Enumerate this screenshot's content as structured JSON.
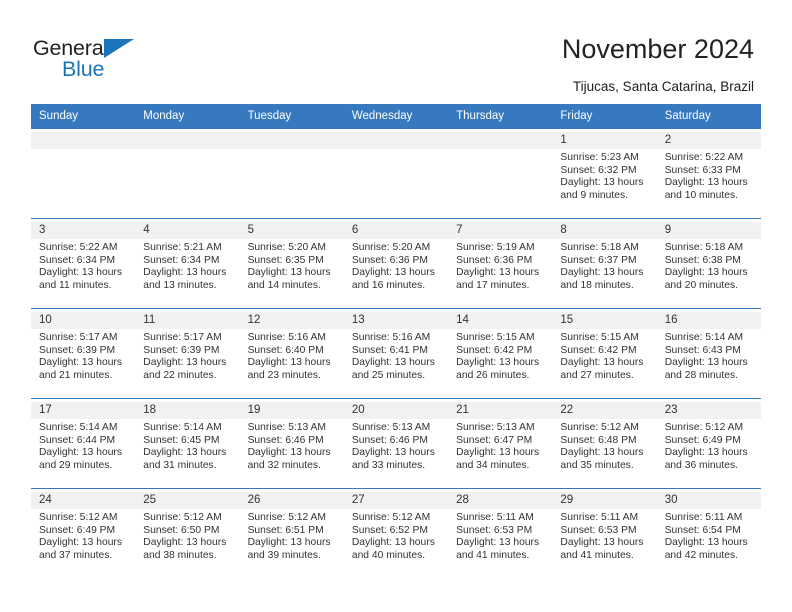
{
  "brand": {
    "name_top": "General",
    "name_bottom": "Blue",
    "color_blue": "#1b75bb",
    "color_dark": "#231f20"
  },
  "header": {
    "title": "November 2024",
    "subtitle": "Tijucas, Santa Catarina, Brazil"
  },
  "theme": {
    "header_row_bg": "#3679bf",
    "daynum_band_bg": "#f1f1f1",
    "text": "#333333"
  },
  "weekdays": [
    "Sunday",
    "Monday",
    "Tuesday",
    "Wednesday",
    "Thursday",
    "Friday",
    "Saturday"
  ],
  "weeks": [
    [
      {
        "empty": true
      },
      {
        "empty": true
      },
      {
        "empty": true
      },
      {
        "empty": true
      },
      {
        "empty": true
      },
      {
        "day": "1",
        "sunrise": "Sunrise: 5:23 AM",
        "sunset": "Sunset: 6:32 PM",
        "daylight_1": "Daylight: 13 hours",
        "daylight_2": "and 9 minutes."
      },
      {
        "day": "2",
        "sunrise": "Sunrise: 5:22 AM",
        "sunset": "Sunset: 6:33 PM",
        "daylight_1": "Daylight: 13 hours",
        "daylight_2": "and 10 minutes."
      }
    ],
    [
      {
        "day": "3",
        "sunrise": "Sunrise: 5:22 AM",
        "sunset": "Sunset: 6:34 PM",
        "daylight_1": "Daylight: 13 hours",
        "daylight_2": "and 11 minutes."
      },
      {
        "day": "4",
        "sunrise": "Sunrise: 5:21 AM",
        "sunset": "Sunset: 6:34 PM",
        "daylight_1": "Daylight: 13 hours",
        "daylight_2": "and 13 minutes."
      },
      {
        "day": "5",
        "sunrise": "Sunrise: 5:20 AM",
        "sunset": "Sunset: 6:35 PM",
        "daylight_1": "Daylight: 13 hours",
        "daylight_2": "and 14 minutes."
      },
      {
        "day": "6",
        "sunrise": "Sunrise: 5:20 AM",
        "sunset": "Sunset: 6:36 PM",
        "daylight_1": "Daylight: 13 hours",
        "daylight_2": "and 16 minutes."
      },
      {
        "day": "7",
        "sunrise": "Sunrise: 5:19 AM",
        "sunset": "Sunset: 6:36 PM",
        "daylight_1": "Daylight: 13 hours",
        "daylight_2": "and 17 minutes."
      },
      {
        "day": "8",
        "sunrise": "Sunrise: 5:18 AM",
        "sunset": "Sunset: 6:37 PM",
        "daylight_1": "Daylight: 13 hours",
        "daylight_2": "and 18 minutes."
      },
      {
        "day": "9",
        "sunrise": "Sunrise: 5:18 AM",
        "sunset": "Sunset: 6:38 PM",
        "daylight_1": "Daylight: 13 hours",
        "daylight_2": "and 20 minutes."
      }
    ],
    [
      {
        "day": "10",
        "sunrise": "Sunrise: 5:17 AM",
        "sunset": "Sunset: 6:39 PM",
        "daylight_1": "Daylight: 13 hours",
        "daylight_2": "and 21 minutes."
      },
      {
        "day": "11",
        "sunrise": "Sunrise: 5:17 AM",
        "sunset": "Sunset: 6:39 PM",
        "daylight_1": "Daylight: 13 hours",
        "daylight_2": "and 22 minutes."
      },
      {
        "day": "12",
        "sunrise": "Sunrise: 5:16 AM",
        "sunset": "Sunset: 6:40 PM",
        "daylight_1": "Daylight: 13 hours",
        "daylight_2": "and 23 minutes."
      },
      {
        "day": "13",
        "sunrise": "Sunrise: 5:16 AM",
        "sunset": "Sunset: 6:41 PM",
        "daylight_1": "Daylight: 13 hours",
        "daylight_2": "and 25 minutes."
      },
      {
        "day": "14",
        "sunrise": "Sunrise: 5:15 AM",
        "sunset": "Sunset: 6:42 PM",
        "daylight_1": "Daylight: 13 hours",
        "daylight_2": "and 26 minutes."
      },
      {
        "day": "15",
        "sunrise": "Sunrise: 5:15 AM",
        "sunset": "Sunset: 6:42 PM",
        "daylight_1": "Daylight: 13 hours",
        "daylight_2": "and 27 minutes."
      },
      {
        "day": "16",
        "sunrise": "Sunrise: 5:14 AM",
        "sunset": "Sunset: 6:43 PM",
        "daylight_1": "Daylight: 13 hours",
        "daylight_2": "and 28 minutes."
      }
    ],
    [
      {
        "day": "17",
        "sunrise": "Sunrise: 5:14 AM",
        "sunset": "Sunset: 6:44 PM",
        "daylight_1": "Daylight: 13 hours",
        "daylight_2": "and 29 minutes."
      },
      {
        "day": "18",
        "sunrise": "Sunrise: 5:14 AM",
        "sunset": "Sunset: 6:45 PM",
        "daylight_1": "Daylight: 13 hours",
        "daylight_2": "and 31 minutes."
      },
      {
        "day": "19",
        "sunrise": "Sunrise: 5:13 AM",
        "sunset": "Sunset: 6:46 PM",
        "daylight_1": "Daylight: 13 hours",
        "daylight_2": "and 32 minutes."
      },
      {
        "day": "20",
        "sunrise": "Sunrise: 5:13 AM",
        "sunset": "Sunset: 6:46 PM",
        "daylight_1": "Daylight: 13 hours",
        "daylight_2": "and 33 minutes."
      },
      {
        "day": "21",
        "sunrise": "Sunrise: 5:13 AM",
        "sunset": "Sunset: 6:47 PM",
        "daylight_1": "Daylight: 13 hours",
        "daylight_2": "and 34 minutes."
      },
      {
        "day": "22",
        "sunrise": "Sunrise: 5:12 AM",
        "sunset": "Sunset: 6:48 PM",
        "daylight_1": "Daylight: 13 hours",
        "daylight_2": "and 35 minutes."
      },
      {
        "day": "23",
        "sunrise": "Sunrise: 5:12 AM",
        "sunset": "Sunset: 6:49 PM",
        "daylight_1": "Daylight: 13 hours",
        "daylight_2": "and 36 minutes."
      }
    ],
    [
      {
        "day": "24",
        "sunrise": "Sunrise: 5:12 AM",
        "sunset": "Sunset: 6:49 PM",
        "daylight_1": "Daylight: 13 hours",
        "daylight_2": "and 37 minutes."
      },
      {
        "day": "25",
        "sunrise": "Sunrise: 5:12 AM",
        "sunset": "Sunset: 6:50 PM",
        "daylight_1": "Daylight: 13 hours",
        "daylight_2": "and 38 minutes."
      },
      {
        "day": "26",
        "sunrise": "Sunrise: 5:12 AM",
        "sunset": "Sunset: 6:51 PM",
        "daylight_1": "Daylight: 13 hours",
        "daylight_2": "and 39 minutes."
      },
      {
        "day": "27",
        "sunrise": "Sunrise: 5:12 AM",
        "sunset": "Sunset: 6:52 PM",
        "daylight_1": "Daylight: 13 hours",
        "daylight_2": "and 40 minutes."
      },
      {
        "day": "28",
        "sunrise": "Sunrise: 5:11 AM",
        "sunset": "Sunset: 6:53 PM",
        "daylight_1": "Daylight: 13 hours",
        "daylight_2": "and 41 minutes."
      },
      {
        "day": "29",
        "sunrise": "Sunrise: 5:11 AM",
        "sunset": "Sunset: 6:53 PM",
        "daylight_1": "Daylight: 13 hours",
        "daylight_2": "and 41 minutes."
      },
      {
        "day": "30",
        "sunrise": "Sunrise: 5:11 AM",
        "sunset": "Sunset: 6:54 PM",
        "daylight_1": "Daylight: 13 hours",
        "daylight_2": "and 42 minutes."
      }
    ]
  ]
}
